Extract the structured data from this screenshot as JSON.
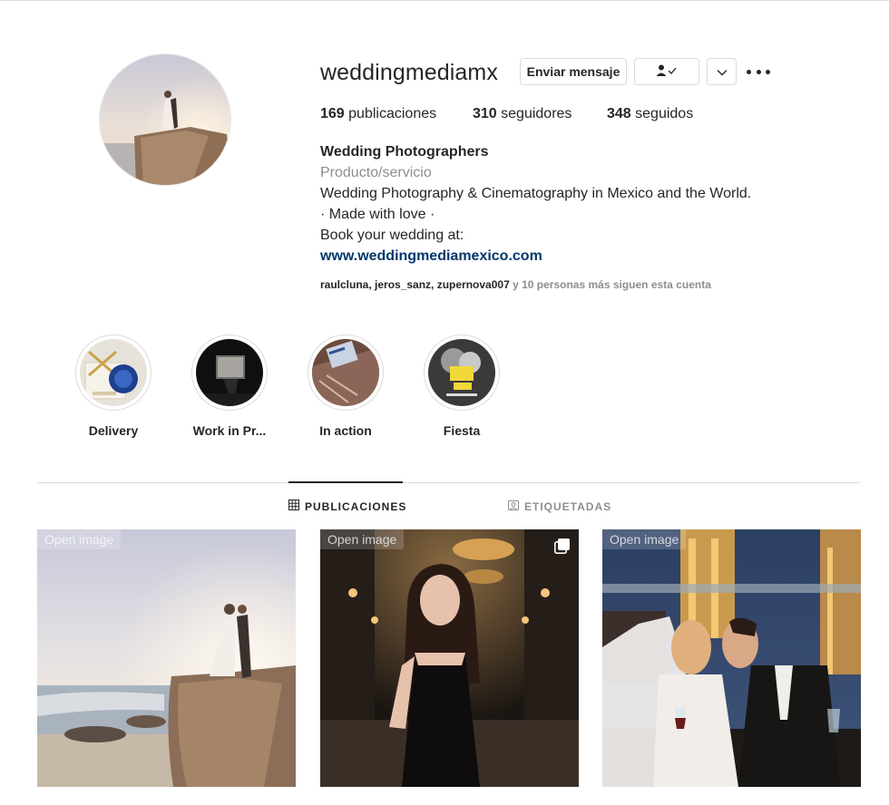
{
  "profile": {
    "username": "weddingmediamx",
    "send_message_label": "Enviar mensaje",
    "stats": {
      "posts_count": "169",
      "posts_label": "publicaciones",
      "followers_count": "310",
      "followers_label": "seguidores",
      "following_count": "348",
      "following_label": "seguidos"
    },
    "bio": {
      "name": "Wedding Photographers",
      "category": "Producto/servicio",
      "line1": "Wedding Photography & Cinematography in Mexico and the World.",
      "line2": "· Made with love ·",
      "line3": "Book your wedding at:",
      "website": "www.weddingmediamexico.com"
    },
    "followed_by": {
      "names": "raulcluna, jeros_sanz, zupernova007",
      "rest": " y 10 personas más siguen esta cuenta"
    }
  },
  "highlights": [
    {
      "label": "Delivery"
    },
    {
      "label": "Work in Pr..."
    },
    {
      "label": "In action"
    },
    {
      "label": "Fiesta"
    }
  ],
  "tabs": {
    "posts": "PUBLICACIONES",
    "tagged": "ETIQUETADAS"
  },
  "posts": [
    {
      "overlay": "Open image"
    },
    {
      "overlay": "Open image"
    },
    {
      "overlay": "Open image"
    }
  ],
  "colors": {
    "text": "#262626",
    "muted": "#8e8e8e",
    "link": "#00376b",
    "border": "#dbdbdb"
  },
  "icons": [
    "person-check-icon",
    "chevron-down-icon",
    "more-icon",
    "grid-icon",
    "tag-icon",
    "multiple-photos-icon"
  ]
}
